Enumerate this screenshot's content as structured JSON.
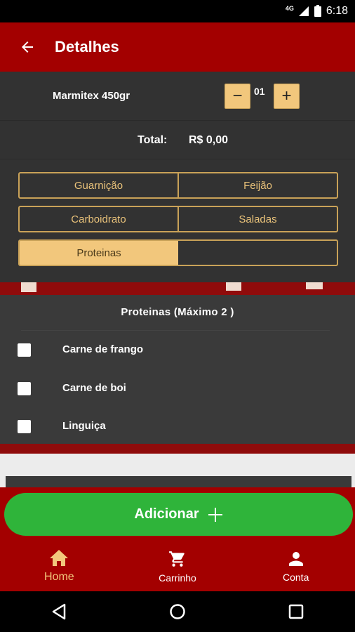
{
  "status_bar": {
    "network": "4G",
    "time": "6:18"
  },
  "header": {
    "back_icon": "arrow-left-icon",
    "title": "Detalhes"
  },
  "product": {
    "name": "Marmitex 450gr",
    "quantity": "01",
    "minus_label": "−",
    "plus_label": "+"
  },
  "total": {
    "label": "Total:",
    "value": "R$ 0,00"
  },
  "tabs": {
    "row1": [
      "Guarnição",
      "Feijão"
    ],
    "row2": [
      "Carboidrato",
      "Saladas"
    ],
    "row3": [
      "Proteinas",
      ""
    ]
  },
  "options_section": {
    "title": "Proteinas (Máximo 2 )",
    "items": [
      "Carne de frango",
      "Carne de boi",
      "Linguiça"
    ]
  },
  "add_button": {
    "label": "Adicionar"
  },
  "bottom_nav": {
    "items": [
      {
        "label": "Home",
        "icon": "home-icon"
      },
      {
        "label": "Carrinho",
        "icon": "cart-icon"
      },
      {
        "label": "Conta",
        "icon": "person-icon"
      }
    ]
  },
  "colors": {
    "primary_red": "#a30000",
    "accent_gold": "#f2c77c",
    "add_green": "#2fb43a",
    "panel_dark": "#323232"
  }
}
